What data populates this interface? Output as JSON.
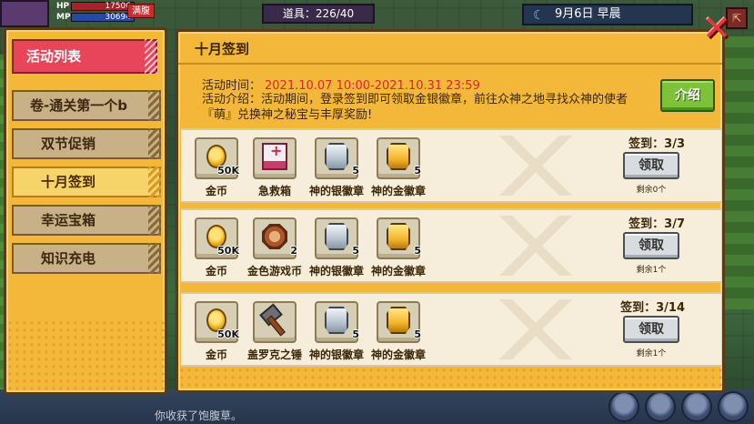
{
  "hud": {
    "hp_label": "HP",
    "hp_value": "17506",
    "mp_label": "MP",
    "mp_value": "30694",
    "status_badge": "满腹",
    "items_text": "道具：226/40",
    "date_text": "9月6日  早晨"
  },
  "menu": {
    "header": "活动列表",
    "items": [
      {
        "label": "卷-通关第一个b"
      },
      {
        "label": "双节促销"
      },
      {
        "label": "十月签到"
      },
      {
        "label": "幸运宝箱"
      },
      {
        "label": "知识充电"
      }
    ],
    "selected_index": 2
  },
  "panel": {
    "title": "十月签到",
    "time_label": "活动时间：",
    "time_value": "2021.10.07 10:00-2021.10.31 23:59",
    "desc": "活动介绍：活动期间，登录签到即可领取金银徽章，前往众神之地寻找众神的使者『萌』兑换神之秘宝与丰厚奖励!",
    "intro_button": "介绍",
    "close_icon": "close-x-icon"
  },
  "rows": [
    {
      "items": [
        {
          "name": "金币",
          "count": "50K",
          "icon": "coin-icon"
        },
        {
          "name": "急救箱",
          "count": "",
          "icon": "firstaid-icon"
        },
        {
          "name": "神的银徽章",
          "count": "5",
          "icon": "silver-badge-icon"
        },
        {
          "name": "神的金徽章",
          "count": "5",
          "icon": "gold-badge-icon"
        }
      ],
      "signin": "签到：3/3",
      "claim": "领取",
      "remain": "剩余0个"
    },
    {
      "items": [
        {
          "name": "金币",
          "count": "50K",
          "icon": "coin-icon"
        },
        {
          "name": "金色游戏币",
          "count": "2",
          "icon": "game-token-icon"
        },
        {
          "name": "神的银徽章",
          "count": "5",
          "icon": "silver-badge-icon"
        },
        {
          "name": "神的金徽章",
          "count": "5",
          "icon": "gold-badge-icon"
        }
      ],
      "signin": "签到：3/7",
      "claim": "领取",
      "remain": "剩余1个"
    },
    {
      "items": [
        {
          "name": "金币",
          "count": "50K",
          "icon": "coin-icon"
        },
        {
          "name": "盖罗克之锤",
          "count": "",
          "icon": "hammer-icon"
        },
        {
          "name": "神的银徽章",
          "count": "5",
          "icon": "silver-badge-icon"
        },
        {
          "name": "神的金徽章",
          "count": "5",
          "icon": "gold-badge-icon"
        }
      ],
      "signin": "签到：3/14",
      "claim": "领取",
      "remain": "剩余1个"
    }
  ],
  "log": {
    "line": "你收获了饱腹草。"
  }
}
